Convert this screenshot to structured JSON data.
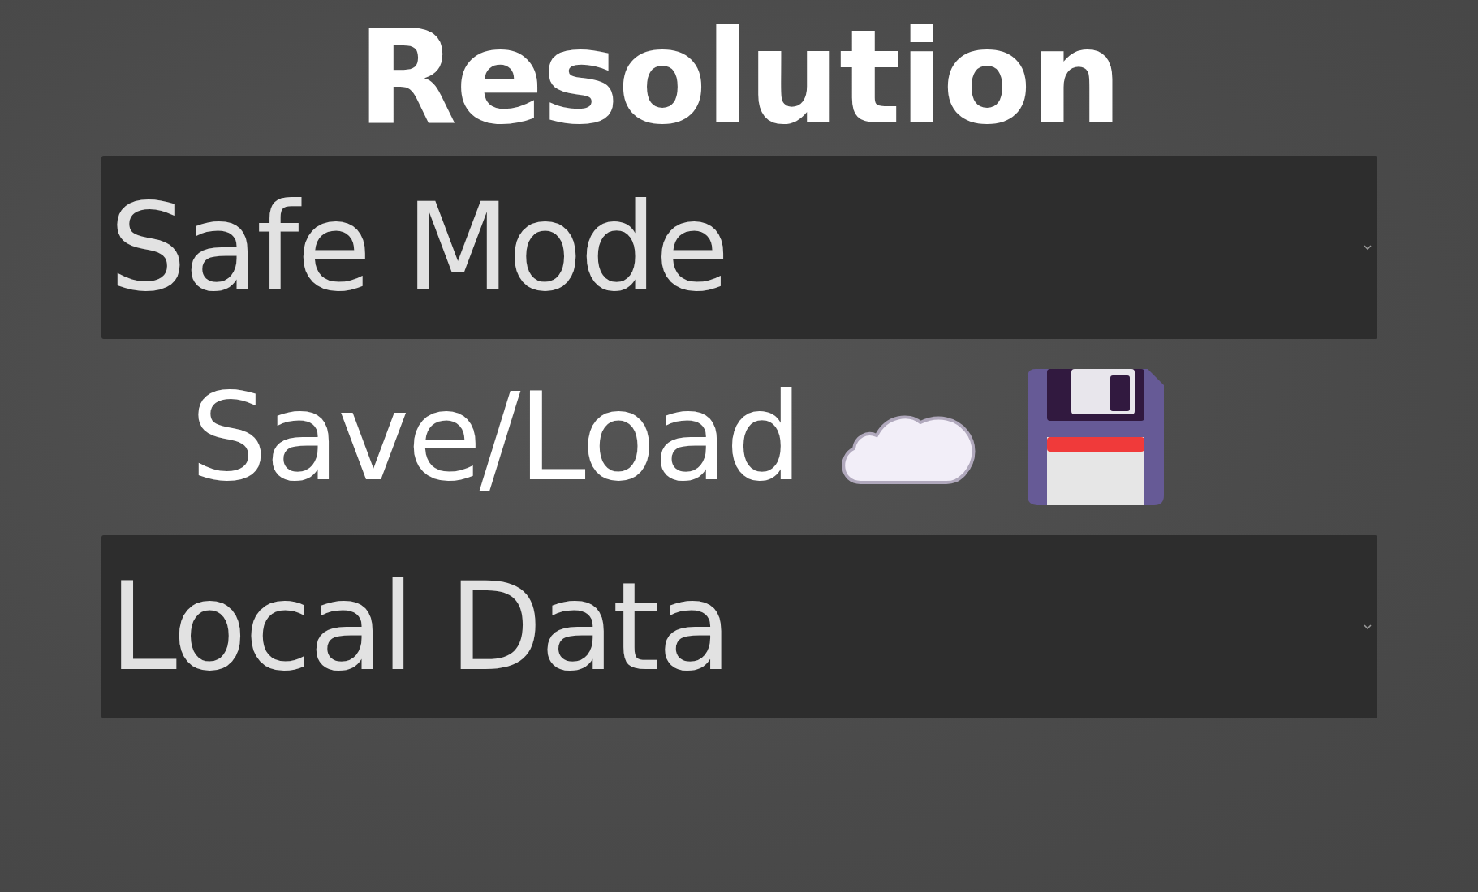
{
  "title": "Resolution",
  "mode_select": {
    "value": "Safe Mode"
  },
  "save_load": {
    "label": "Save/Load"
  },
  "storage_select": {
    "value": "Local Data"
  }
}
